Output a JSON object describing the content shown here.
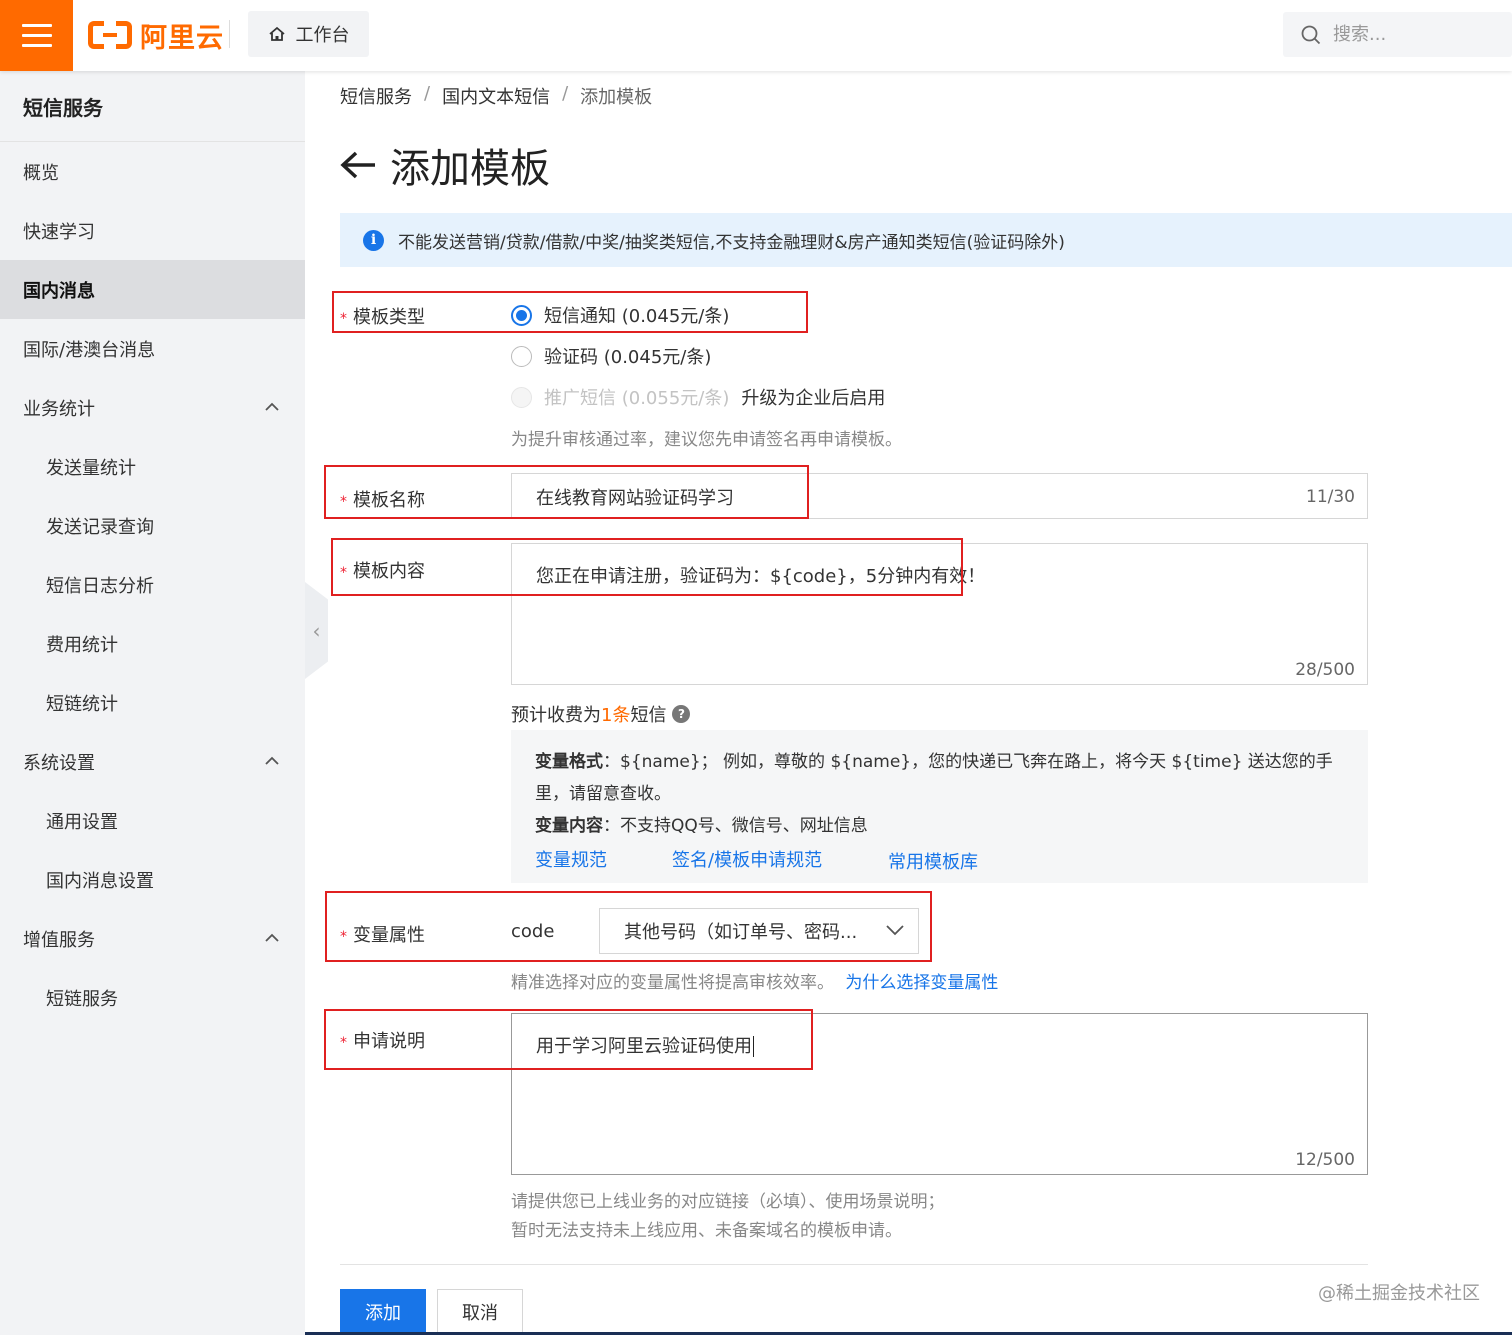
{
  "topbar": {
    "logo_text": "阿里云",
    "workbench_label": "工作台",
    "search_placeholder": "搜索..."
  },
  "sidebar": {
    "title": "短信服务",
    "items": [
      {
        "label": "概览",
        "level": 0
      },
      {
        "label": "快速学习",
        "level": 0
      },
      {
        "label": "国内消息",
        "level": 0,
        "active": true
      },
      {
        "label": "国际/港澳台消息",
        "level": 0
      },
      {
        "label": "业务统计",
        "level": 0,
        "expandable": true
      },
      {
        "label": "发送量统计",
        "level": 1
      },
      {
        "label": "发送记录查询",
        "level": 1
      },
      {
        "label": "短信日志分析",
        "level": 1
      },
      {
        "label": "费用统计",
        "level": 1
      },
      {
        "label": "短链统计",
        "level": 1
      },
      {
        "label": "系统设置",
        "level": 0,
        "expandable": true
      },
      {
        "label": "通用设置",
        "level": 1
      },
      {
        "label": "国内消息设置",
        "level": 1
      },
      {
        "label": "增值服务",
        "level": 0,
        "expandable": true
      },
      {
        "label": "短链服务",
        "level": 1
      }
    ]
  },
  "breadcrumb": [
    "短信服务",
    "国内文本短信",
    "添加模板"
  ],
  "page_title": "添加模板",
  "notice": "不能发送营销/贷款/借款/中奖/抽奖类短信,不支持金融理财&房产通知类短信(验证码除外)",
  "form": {
    "template_type": {
      "label": "模板类型",
      "options": [
        {
          "label": "短信通知 (0.045元/条)",
          "checked": true
        },
        {
          "label": "验证码 (0.045元/条)",
          "checked": false
        },
        {
          "label": "推广短信 (0.055元/条)",
          "disabled": true,
          "suffix": "升级为企业后启用"
        }
      ],
      "hint": "为提升审核通过率，建议您先申请签名再申请模板。"
    },
    "template_name": {
      "label": "模板名称",
      "value": "在线教育网站验证码学习",
      "counter": "11/30"
    },
    "template_content": {
      "label": "模板内容",
      "value": "您正在申请注册，验证码为：${code}，5分钟内有效！",
      "counter": "28/500"
    },
    "estimate": {
      "prefix": "预计收费为",
      "highlight": "1条",
      "suffix": "短信"
    },
    "variable_info": {
      "format_label": "变量格式",
      "format_text": "：${name}；  例如，尊敬的 ${name}，您的快递已飞奔在路上，将今天 ${time} 送达您的手里，请留意查收。",
      "content_label": "变量内容",
      "content_text": "：不支持QQ号、微信号、网址信息",
      "links": [
        "变量规范",
        "签名/模板申请规范",
        "常用模板库"
      ]
    },
    "variable_attr": {
      "label": "变量属性",
      "var_name": "code",
      "selected": "其他号码（如订单号、密码...",
      "hint": "精准选择对应的变量属性将提高审核效率。",
      "hint_link": "为什么选择变量属性"
    },
    "description": {
      "label": "申请说明",
      "value": "用于学习阿里云验证码使用",
      "counter": "12/500",
      "hint_lines": [
        "请提供您已上线业务的对应链接（必填）、使用场景说明；",
        "暂时无法支持未上线应用、未备案域名的模板申请。"
      ]
    }
  },
  "actions": {
    "submit": "添加",
    "cancel": "取消"
  },
  "watermark": "@稀土掘金技术社区",
  "colors": {
    "brand": "#ff6a00",
    "primary": "#1875e8",
    "highlight_border": "#e02020"
  }
}
